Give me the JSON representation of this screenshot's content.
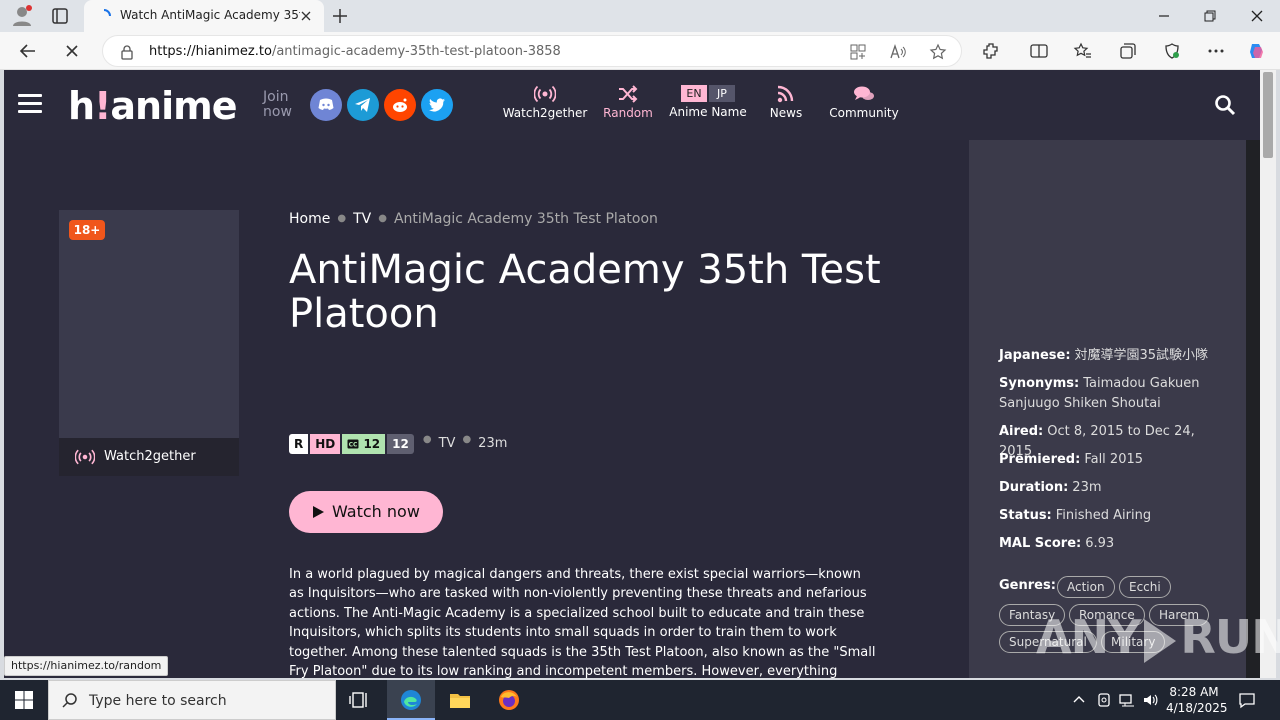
{
  "browser": {
    "tab_title": "Watch AntiMagic Academy 35th Test Platoon",
    "url_domain": "https://hianimez.to",
    "url_path": "/antimagic-academy-35th-test-platoon-3858",
    "status_url": "https://hianimez.to/random"
  },
  "site": {
    "logo_main": "h",
    "logo_excl": "!",
    "logo_rest": "anime",
    "join_line1": "Join",
    "join_line2": "now",
    "nav": {
      "watch2gether": "Watch2gether",
      "random": "Random",
      "anime_name": "Anime Name",
      "lang_en": "EN",
      "lang_jp": "JP",
      "news": "News",
      "community": "Community"
    }
  },
  "anime": {
    "age_badge": "18+",
    "watch2gether_label": "Watch2gether",
    "breadcrumb": [
      "Home",
      "TV",
      "AntiMagic Academy 35th Test Platoon"
    ],
    "title": "AntiMagic Academy 35th Test Platoon",
    "ticks": {
      "rating": "R",
      "quality": "HD",
      "sub": "12",
      "eps": "12"
    },
    "type": "TV",
    "duration": "23m",
    "watch_label": "Watch now",
    "synopsis": "In a world plagued by magical dangers and threats, there exist special warriors—known as Inquisitors—who are tasked with non-violently preventing these threats and nefarious actions. The Anti-Magic Academy is a specialized school built to educate and train these Inquisitors, which splits its students into small squads in order to train them to work together. Among these talented squads is the 35th Test Platoon, also known as the \"Small Fry Platoon\" due to its low ranking and incompetent members. However, everything changes when Ouka Ootori, a powerful yet rebellious former Inquisitor, is forced into joining due to her tendency to break rules and committing a serious violation: the killing of a witch. Tempers flare upon her arrival, as she clashes with their clumsy captain Takeru"
  },
  "sidebar": {
    "japanese_label": "Japanese:",
    "japanese": "対魔導学園35試験小隊",
    "synonyms_label": "Synonyms:",
    "synonyms": "Taimadou Gakuen Sanjuugo Shiken Shoutai",
    "aired_label": "Aired:",
    "aired": "Oct 8, 2015 to Dec 24, 2015",
    "premiered_label": "Premiered:",
    "premiered": "Fall 2015",
    "duration_label": "Duration:",
    "duration": "23m",
    "status_label": "Status:",
    "status": "Finished Airing",
    "mal_label": "MAL Score:",
    "mal": "6.93",
    "genres_label": "Genres:",
    "genres": [
      "Action",
      "Ecchi",
      "Fantasy",
      "Romance",
      "Harem",
      "Supernatural",
      "Military"
    ]
  },
  "watermark": {
    "left": "ANY",
    "right": "RUN"
  },
  "taskbar": {
    "search_placeholder": "Type here to search",
    "time": "8:28 AM",
    "date": "4/18/2025"
  },
  "colors": {
    "accent_pink": "#ffb6d3",
    "badge_orange": "#f0561b",
    "header_bg": "#2b2a3b"
  }
}
